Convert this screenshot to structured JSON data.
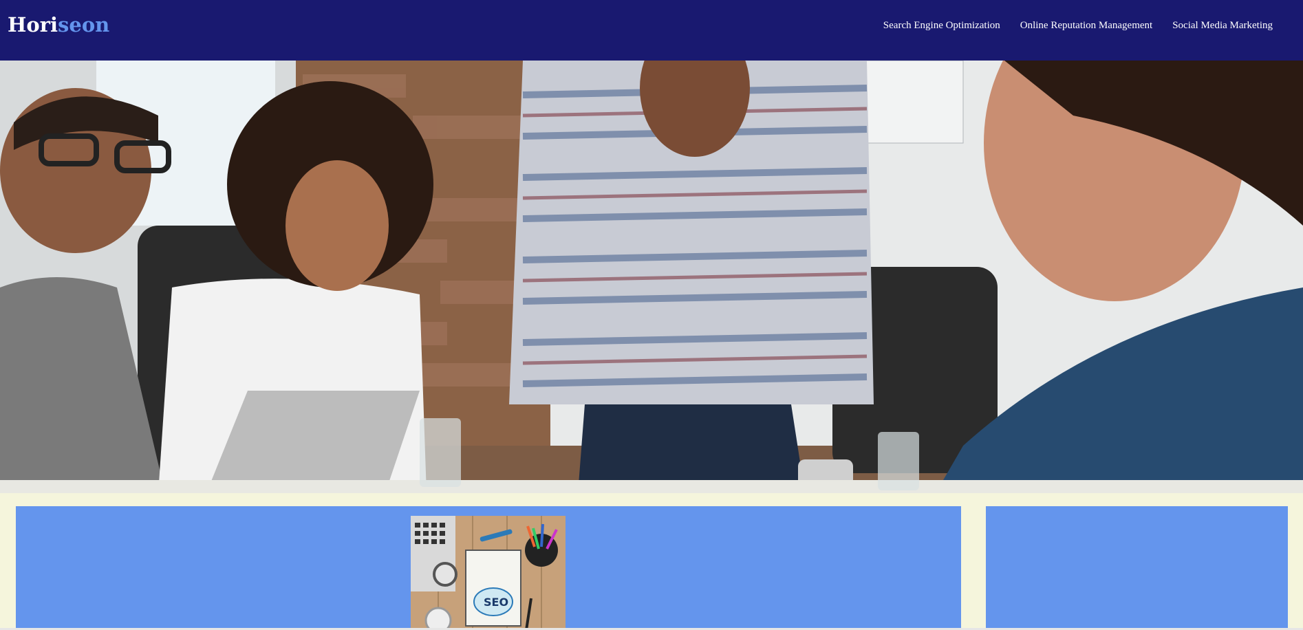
{
  "header": {
    "logo_prefix": "Hori",
    "logo_accent": "seon",
    "nav": [
      {
        "label": "Search Engine Optimization"
      },
      {
        "label": "Online Reputation Management"
      },
      {
        "label": "Social Media Marketing"
      }
    ]
  },
  "hero": {
    "image": "team-meeting-photo"
  },
  "content": {
    "image": "seo-desk-photo",
    "seo_label": "SEO"
  },
  "colors": {
    "header_bg": "#191970",
    "logo_accent": "#6495ed",
    "page_bg": "#f5f5dc",
    "panel_bg": "#6495ed"
  }
}
